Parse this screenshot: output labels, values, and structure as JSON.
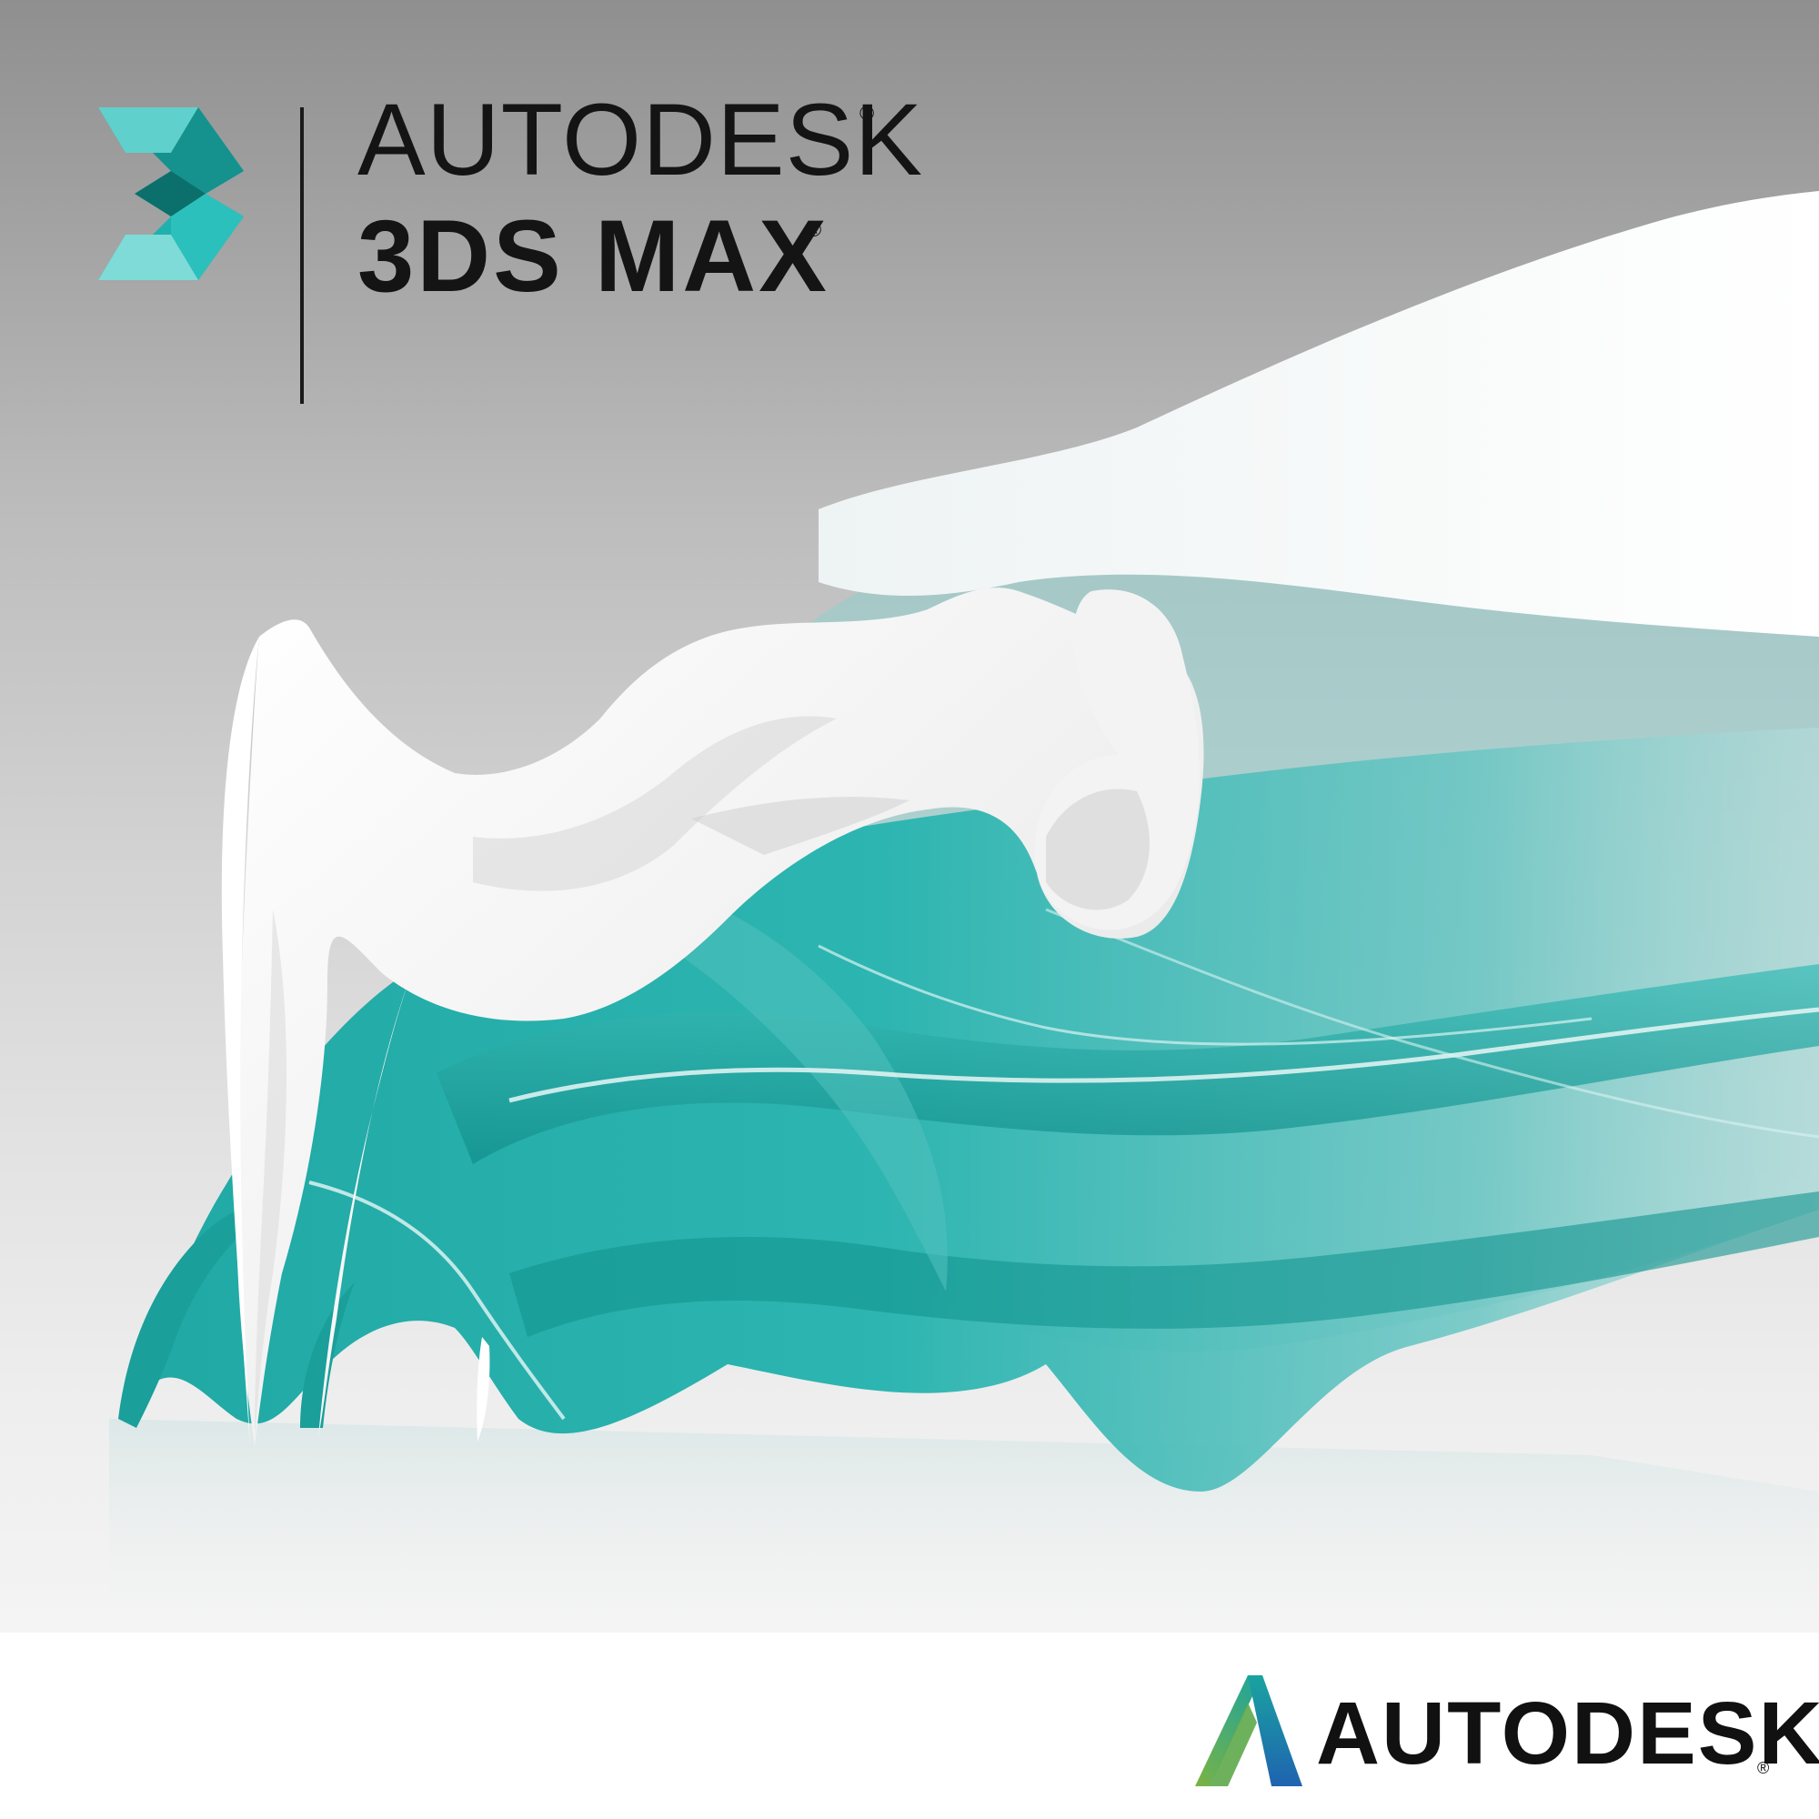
{
  "lockup": {
    "brand_text": "AUTODESK",
    "product_text": "3DS MAX",
    "registered_mark": "®",
    "logo_icon": "3ds-max-logo-icon"
  },
  "footer": {
    "corp_wordmark": "AUTODESK",
    "registered_mark": "®",
    "logo_icon": "autodesk-a-logo-icon"
  },
  "colors": {
    "teal": "#2fb3b0",
    "teal_dark": "#0f8d8a",
    "cloth_white": "#f2f2f2",
    "background_top": "#8f8f8f",
    "background_bottom": "#f4f4f4",
    "text": "#141414",
    "corp_logo_green": "#7cb342",
    "corp_logo_blue": "#1f63b0",
    "corp_logo_teal": "#1aa3a0"
  }
}
